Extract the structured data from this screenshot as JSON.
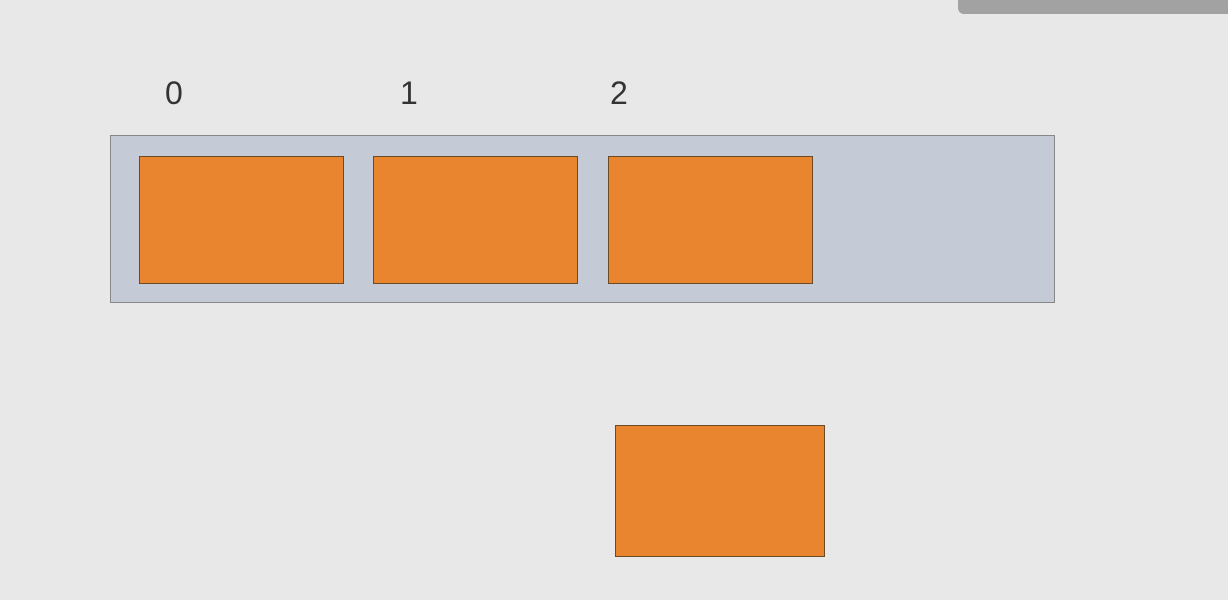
{
  "indices": {
    "label_0": "0",
    "label_1": "1",
    "label_2": "2"
  },
  "colors": {
    "background": "#e8e8e8",
    "container": "#c4cbd6",
    "cell": "#e8852e",
    "cell_border": "#6b4a28"
  }
}
